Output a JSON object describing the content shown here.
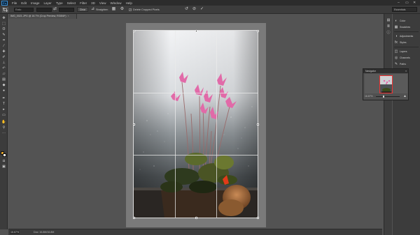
{
  "app": {
    "logo": "Ps"
  },
  "menu": [
    "File",
    "Edit",
    "Image",
    "Layer",
    "Type",
    "Select",
    "Filter",
    "3D",
    "View",
    "Window",
    "Help"
  ],
  "window_controls": [
    "–",
    "▭",
    "✕"
  ],
  "options_bar": {
    "ratio_select": "Ratio",
    "clear_label": "Clear",
    "straighten_label": "Straighten",
    "delete_cropped_label": "Delete Cropped Pixels",
    "delete_cropped_checked": "✓",
    "workspace": "Essentials"
  },
  "document": {
    "tab_title": "IMG_0021.JPG @ 16.7% (Crop Preview, RGB/8*)",
    "tab_close": "×"
  },
  "status": {
    "zoom": "16.67%",
    "doc_size": "Doc: 16.8M/16.8M"
  },
  "panel_dock": [
    {
      "icon": "color-icon",
      "glyph": "◐",
      "label": "Color"
    },
    {
      "icon": "swatches-icon",
      "glyph": "▦",
      "label": "Swatches"
    },
    {
      "icon": "adjustments-icon",
      "glyph": "◑",
      "label": "Adjustments"
    },
    {
      "icon": "styles-icon",
      "glyph": "fx",
      "label": "Styles"
    },
    {
      "icon": "layers-icon",
      "glyph": "◫",
      "label": "Layers"
    },
    {
      "icon": "channels-icon",
      "glyph": "◎",
      "label": "Channels"
    },
    {
      "icon": "paths-icon",
      "glyph": "✎",
      "label": "Paths"
    }
  ],
  "navigator": {
    "title": "Navigator",
    "menu": "≡",
    "zoom": "16.67%"
  },
  "colors": {
    "foreground": "#e7a629",
    "background": "#ffffff",
    "nav_frame": "#ee3333"
  }
}
